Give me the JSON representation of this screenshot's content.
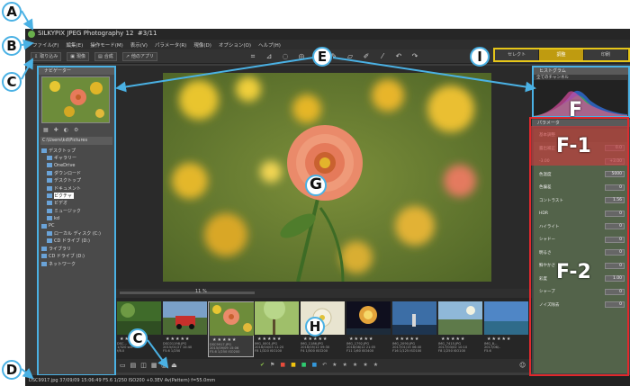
{
  "app": {
    "title": "SILKYPIX JPEG Photography 12",
    "image_counter": "#3/11"
  },
  "menu": [
    "ファイル(F)",
    "編集(E)",
    "操作モード(M)",
    "表示(V)",
    "パラメータ(R)",
    "現像(D)",
    "オプション(O)",
    "ヘルプ(H)"
  ],
  "toolbar": {
    "left_buttons": [
      "取り込み",
      "現像",
      "合成",
      "他のアプリ"
    ],
    "tools": [
      "crop",
      "rotate",
      "spot",
      "redeye",
      "brush",
      "pen",
      "eraser",
      "picker"
    ],
    "modes": [
      {
        "label": "セレクト",
        "active": false
      },
      {
        "label": "調整",
        "active": true
      },
      {
        "label": "印刷",
        "active": false
      }
    ]
  },
  "left_panel": {
    "navigator_title": "ナビゲーター",
    "path": "C:\\Users\\kd\\Pictures",
    "tree": [
      "デスクトップ",
      "ギャラリー",
      "OneDrive",
      "ダウンロード",
      "デスクトップ",
      "ドキュメント",
      "ピクチャ",
      "ビデオ",
      "ミュージック",
      "kd",
      "PC",
      "ローカル ディスク (C:)",
      "CD ドライブ (D:)",
      "ライブラリ",
      "CD ドライブ (D:)",
      "ネットワーク"
    ],
    "selected_item": "ピクチャ"
  },
  "film": {
    "zoom": "11 %",
    "thumbnails": [
      {
        "stars": "★★★★★",
        "meta": "DSC...\n1/320 sec\nf/8.0"
      },
      {
        "stars": "★★★★★",
        "meta": "DSC01198.JPG\n2015/01/27 10:40\nF5.6 1/250"
      },
      {
        "stars": "★★★★★",
        "meta": "DSC9917.JPG\n2015/09/09 15:06\nF5.6 1/250 ISO200"
      },
      {
        "stars": "★★★★★",
        "meta": "IMG_0001.JPG\n2016/04/03 11:20\nF8 1/320 ISO100"
      },
      {
        "stars": "★★★★★",
        "meta": "IMG_1186.JPG\n2016/05/12 09:30\nF4 1/500 ISO200"
      },
      {
        "stars": "★★★★★",
        "meta": "IMG_1792.JPG\n2016/08/12 21:05\nF11 1/60 ISO400"
      },
      {
        "stars": "★★★★★",
        "meta": "IMG_2090.JPG\n2017/01/15 06:40\nF16 1/125 ISO100"
      },
      {
        "stars": "★★★★★",
        "meta": "IMG_7415.JPG\n2017/03/02 10:10\nF8 1/250 ISO100"
      },
      {
        "stars": "★★★★★",
        "meta": "IMG_8...\n2017/06/..\nF5.6"
      }
    ]
  },
  "status": {
    "text": "DSC9917.jpg 37/09/09 15:06:49 F5.6 1/250 ISO200 +0.3EV Av(Pattern) f=55.0mm"
  },
  "right_panel": {
    "histogram_title": "ヒストグラム",
    "histogram_channel": "全てのチャンネル",
    "control_title": "パラメータ",
    "rows": [
      {
        "label": "基本調整",
        "value": ""
      },
      {
        "label": "露出補正",
        "value": "0.0"
      },
      {
        "label": "-3.00",
        "value": "+3.00"
      },
      {
        "label": "色温度",
        "value": "5000"
      },
      {
        "label": "色偏差",
        "value": "0"
      },
      {
        "label": "コントラスト",
        "value": "1.56"
      },
      {
        "label": "HDR",
        "value": "0"
      },
      {
        "label": "ハイライト",
        "value": "0"
      },
      {
        "label": "シャドー",
        "value": "0"
      },
      {
        "label": "明るさ",
        "value": "0"
      },
      {
        "label": "鮮やかさ",
        "value": "0"
      },
      {
        "label": "彩度",
        "value": "1.00"
      },
      {
        "label": "シャープ",
        "value": "0"
      },
      {
        "label": "ノイズ除去",
        "value": "0"
      }
    ]
  },
  "annotations": {
    "callouts": [
      "A",
      "B",
      "C",
      "C",
      "D",
      "E",
      "G",
      "H",
      "I"
    ],
    "panel_labels": [
      "F",
      "F-1",
      "F-2"
    ]
  }
}
